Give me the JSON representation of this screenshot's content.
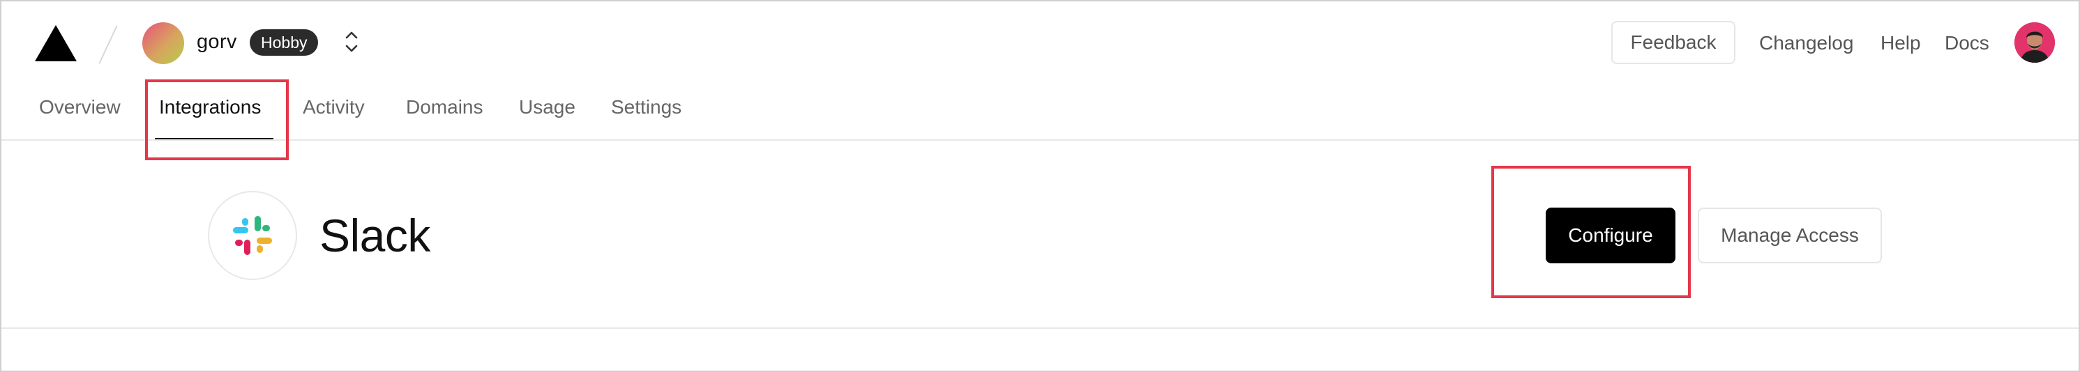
{
  "header": {
    "team": {
      "name": "gorv",
      "plan": "Hobby"
    },
    "links": {
      "feedback": "Feedback",
      "changelog": "Changelog",
      "help": "Help",
      "docs": "Docs"
    }
  },
  "tabs": [
    {
      "label": "Overview",
      "active": false
    },
    {
      "label": "Integrations",
      "active": true
    },
    {
      "label": "Activity",
      "active": false
    },
    {
      "label": "Domains",
      "active": false
    },
    {
      "label": "Usage",
      "active": false
    },
    {
      "label": "Settings",
      "active": false
    }
  ],
  "integration": {
    "name": "Slack",
    "icon": "slack-logo",
    "actions": {
      "configure": "Configure",
      "manage_access": "Manage Access"
    }
  },
  "colors": {
    "highlight": "#e5364a",
    "primary_button": "#000000",
    "active_tab_underline": "#111111"
  }
}
